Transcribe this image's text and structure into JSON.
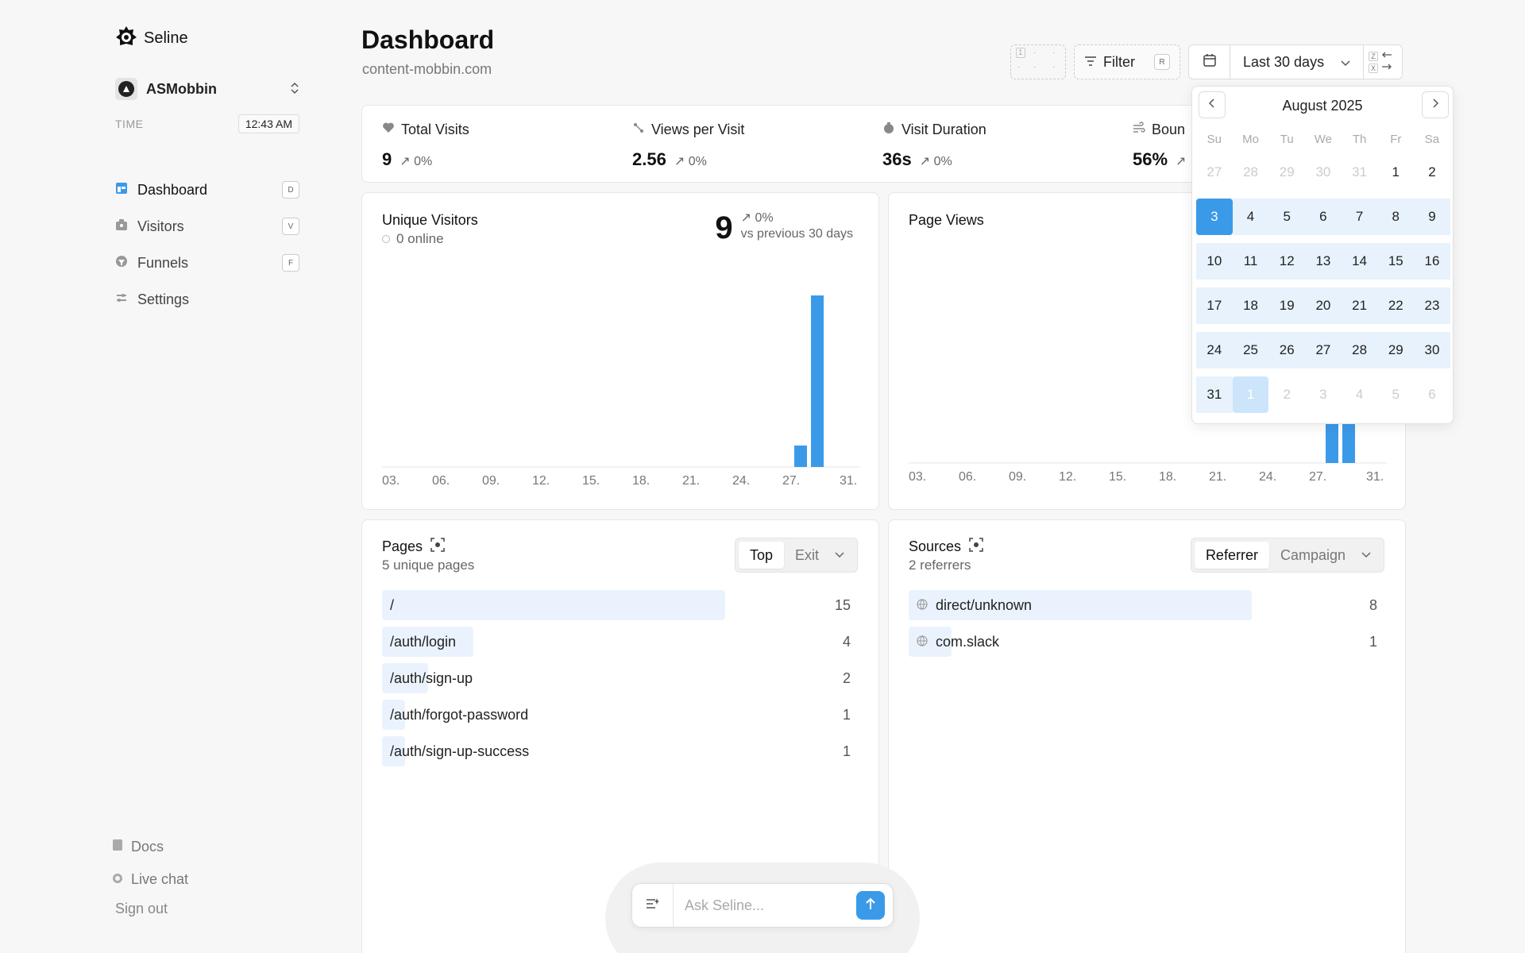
{
  "app": {
    "name": "Seline"
  },
  "project": {
    "name": "ASMobbin"
  },
  "clock": {
    "label": "TIME",
    "value": "12:43 AM"
  },
  "nav": [
    {
      "label": "Dashboard",
      "key": "D"
    },
    {
      "label": "Visitors",
      "key": "V"
    },
    {
      "label": "Funnels",
      "key": "F"
    },
    {
      "label": "Settings",
      "key": ""
    }
  ],
  "footer": {
    "docs": "Docs",
    "live_chat": "Live chat",
    "sign_out": "Sign out"
  },
  "header": {
    "title": "Dashboard",
    "domain": "content-mobbin.com",
    "filter_label": "Filter",
    "filter_key": "R",
    "date_range": "Last 30 days",
    "prev_key": "Z",
    "next_key": "X",
    "compare_box_digit": "1"
  },
  "stats": [
    {
      "label": "Total Visits",
      "value": "9",
      "change": "0%"
    },
    {
      "label": "Views per Visit",
      "value": "2.56",
      "change": "0%"
    },
    {
      "label": "Visit Duration",
      "value": "36s",
      "change": "0%"
    },
    {
      "label": "Boun",
      "value": "56%",
      "change": ""
    }
  ],
  "unique_visitors": {
    "title": "Unique Visitors",
    "online": "0 online",
    "value": "9",
    "change": "0%",
    "comparison": "vs previous 30 days"
  },
  "page_views": {
    "title": "Page Views"
  },
  "chart_data": [
    {
      "type": "bar",
      "title": "Unique Visitors",
      "x_ticks": [
        "03.",
        "06.",
        "09.",
        "12.",
        "15.",
        "18.",
        "21.",
        "24.",
        "27.",
        "31."
      ],
      "bars": [
        {
          "day": 28,
          "value": 1
        },
        {
          "day": 29,
          "value": 8
        }
      ]
    },
    {
      "type": "bar",
      "title": "Page Views",
      "x_ticks": [
        "03.",
        "06.",
        "09.",
        "12.",
        "15.",
        "18.",
        "21.",
        "24.",
        "27.",
        "31."
      ],
      "bars": [
        {
          "day": 28,
          "value": 3
        },
        {
          "day": 29,
          "value": 3
        }
      ]
    }
  ],
  "calendar": {
    "month": "August 2025",
    "weekdays": [
      "Su",
      "Mo",
      "Tu",
      "We",
      "Th",
      "Fr",
      "Sa"
    ],
    "weeks": [
      [
        "27",
        "28",
        "29",
        "30",
        "31",
        "1",
        "2"
      ],
      [
        "3",
        "4",
        "5",
        "6",
        "7",
        "8",
        "9"
      ],
      [
        "10",
        "11",
        "12",
        "13",
        "14",
        "15",
        "16"
      ],
      [
        "17",
        "18",
        "19",
        "20",
        "21",
        "22",
        "23"
      ],
      [
        "24",
        "25",
        "26",
        "27",
        "28",
        "29",
        "30"
      ],
      [
        "31",
        "1",
        "2",
        "3",
        "4",
        "5",
        "6"
      ]
    ],
    "selected_start": "3",
    "selected_end": "1"
  },
  "pages": {
    "title": "Pages",
    "subtitle": "5 unique pages",
    "tabs": [
      "Top",
      "Exit"
    ],
    "active_tab": "Top",
    "rows": [
      {
        "label": "/",
        "count": 15
      },
      {
        "label": "/auth/login",
        "count": 4
      },
      {
        "label": "/auth/sign-up",
        "count": 2
      },
      {
        "label": "/auth/forgot-password",
        "count": 1
      },
      {
        "label": "/auth/sign-up-success",
        "count": 1
      }
    ]
  },
  "sources": {
    "title": "Sources",
    "subtitle": "2 referrers",
    "tabs": [
      "Referrer",
      "Campaign"
    ],
    "active_tab": "Referrer",
    "rows": [
      {
        "label": "direct/unknown",
        "count": 8
      },
      {
        "label": "com.slack",
        "count": 1
      }
    ]
  },
  "ask": {
    "placeholder": "Ask Seline..."
  },
  "colors": {
    "accent": "#3b9ae8",
    "bar_bg": "#eaf3fd",
    "range_bg": "#e8f2fd"
  }
}
